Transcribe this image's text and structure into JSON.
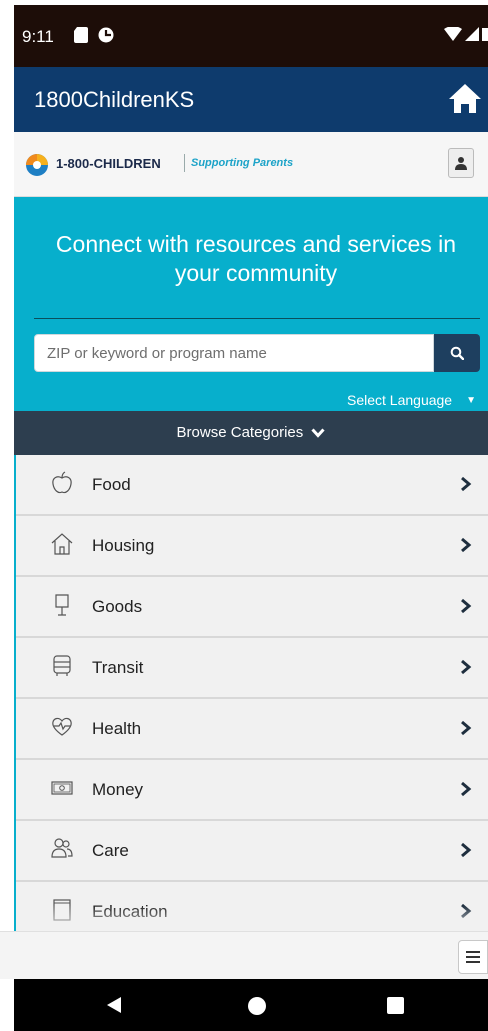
{
  "status": {
    "time": "9:11"
  },
  "header": {
    "title": "1800ChildrenKS"
  },
  "brand": {
    "name": "1-800-CHILDREN",
    "tagline": "Supporting Parents"
  },
  "hero": {
    "heading": "Connect with resources and services in your community",
    "search_placeholder": "ZIP or keyword or program name",
    "language_label": "Select Language"
  },
  "browse": {
    "label": "Browse Categories"
  },
  "categories": [
    {
      "label": "Food",
      "icon": "apple-icon"
    },
    {
      "label": "Housing",
      "icon": "house-icon"
    },
    {
      "label": "Goods",
      "icon": "lamp-icon"
    },
    {
      "label": "Transit",
      "icon": "bus-icon"
    },
    {
      "label": "Health",
      "icon": "heart-pulse-icon"
    },
    {
      "label": "Money",
      "icon": "money-icon"
    },
    {
      "label": "Care",
      "icon": "people-icon"
    },
    {
      "label": "Education",
      "icon": "book-icon"
    }
  ],
  "colors": {
    "header_bg": "#0e3b6d",
    "hero_bg": "#07afcc",
    "browse_bg": "#2d3e4f",
    "brand_tagline": "#1ca3c8"
  }
}
